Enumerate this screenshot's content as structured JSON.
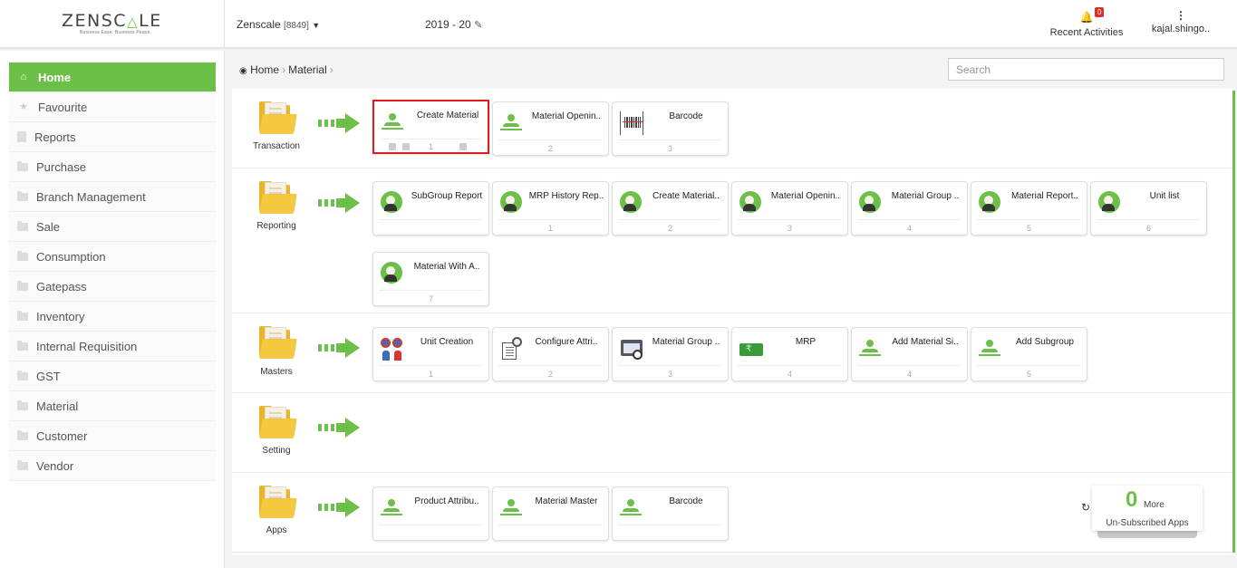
{
  "header": {
    "logo_pre": "ZENSC",
    "logo_mark": "△",
    "logo_post": "LE",
    "logo_tagline": "Business Ease. Business Peace.",
    "company_name": "Zenscale",
    "company_code": "[8849]",
    "year": "2019 - 20",
    "recent_label": "Recent Activities",
    "notification_count": "0",
    "user_name": "kajal.shingo.."
  },
  "sidebar": {
    "items": [
      {
        "label": "Home",
        "icon": "home-icon",
        "active": true
      },
      {
        "label": "Favourite",
        "icon": "star-icon"
      },
      {
        "label": "Reports",
        "icon": "document-icon"
      },
      {
        "label": "Purchase",
        "icon": "folder-icon"
      },
      {
        "label": "Branch Management",
        "icon": "folder-icon"
      },
      {
        "label": "Sale",
        "icon": "folder-icon"
      },
      {
        "label": "Consumption",
        "icon": "folder-icon"
      },
      {
        "label": "Gatepass",
        "icon": "folder-icon"
      },
      {
        "label": "Inventory",
        "icon": "folder-icon"
      },
      {
        "label": "Internal Requisition",
        "icon": "folder-icon"
      },
      {
        "label": "GST",
        "icon": "folder-icon"
      },
      {
        "label": "Material",
        "icon": "folder-icon"
      },
      {
        "label": "Customer",
        "icon": "folder-icon"
      },
      {
        "label": "Vendor",
        "icon": "folder-icon"
      }
    ]
  },
  "breadcrumb": {
    "home": "Home",
    "current": "Material"
  },
  "search": {
    "placeholder": "Search"
  },
  "colors": {
    "accent": "#6cc04a",
    "selected_border": "#e01b1b",
    "badge": "#d9302a"
  },
  "sections": {
    "transaction": {
      "label": "Transaction",
      "cards": [
        {
          "title": "Create Material",
          "num": "1"
        },
        {
          "title": "Material Openin..",
          "num": "2"
        },
        {
          "title": "Barcode",
          "num": "3"
        }
      ]
    },
    "reporting": {
      "label": "Reporting",
      "cards": [
        {
          "title": "SubGroup Report",
          "num": ""
        },
        {
          "title": "MRP History Rep..",
          "num": "1"
        },
        {
          "title": "Create Material..",
          "num": "2"
        },
        {
          "title": "Material Openin..",
          "num": "3"
        },
        {
          "title": "Material Group ..",
          "num": "4"
        },
        {
          "title": "Material Report..",
          "num": "5"
        },
        {
          "title": "Unit list",
          "num": "6"
        },
        {
          "title": "Material With A..",
          "num": "7"
        }
      ]
    },
    "masters": {
      "label": "Masters",
      "cards": [
        {
          "title": "Unit Creation",
          "num": "1"
        },
        {
          "title": "Configure Attri..",
          "num": "2"
        },
        {
          "title": "Material Group ..",
          "num": "3"
        },
        {
          "title": "MRP",
          "num": "4"
        },
        {
          "title": "Add Material Si..",
          "num": "4"
        },
        {
          "title": "Add Subgroup",
          "num": "5"
        }
      ]
    },
    "setting": {
      "label": "Setting"
    },
    "apps": {
      "label": "Apps",
      "cards": [
        {
          "title": "Product Attribu..",
          "num": ""
        },
        {
          "title": "Material Master",
          "num": ""
        },
        {
          "title": "Barcode",
          "num": ""
        }
      ]
    }
  },
  "unsubscribed": {
    "count": "0",
    "more": "More",
    "label": "Un-Subscribed Apps"
  }
}
